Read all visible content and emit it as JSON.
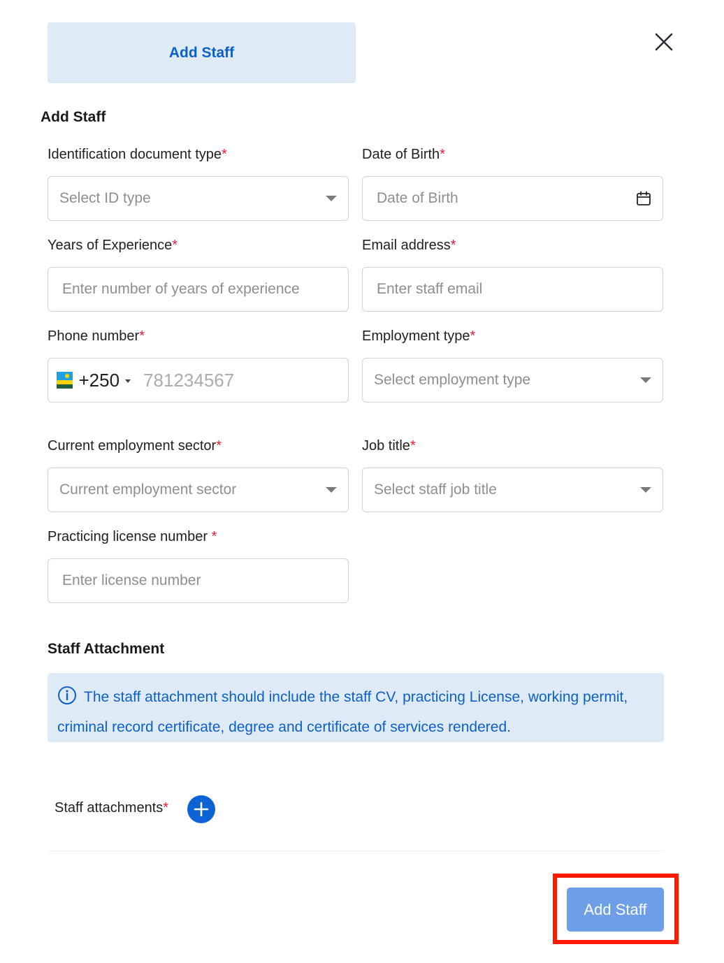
{
  "header": {
    "tab_label": "Add Staff"
  },
  "form": {
    "title": "Add Staff",
    "required_mark": "*",
    "id_type": {
      "label": "Identification document type",
      "placeholder": "Select ID type"
    },
    "dob": {
      "label": "Date of Birth",
      "placeholder": "Date of Birth"
    },
    "experience": {
      "label": "Years of Experience",
      "placeholder": "Enter number of years of experience"
    },
    "email": {
      "label": "Email address",
      "placeholder": "Enter staff email"
    },
    "phone": {
      "label": "Phone number",
      "dial_code": "+250",
      "placeholder": "781234567",
      "country_flag": "rwanda-flag"
    },
    "employment_type": {
      "label": "Employment type",
      "placeholder": "Select employment type"
    },
    "sector": {
      "label": "Current employment sector",
      "placeholder": "Current employment sector"
    },
    "job_title": {
      "label": "Job title",
      "placeholder": "Select staff job title"
    },
    "license": {
      "label": "Practicing license number ",
      "placeholder": "Enter license number"
    }
  },
  "attachments": {
    "title": "Staff Attachment",
    "info_text": "The staff attachment should include the staff CV, practicing License, working permit, criminal record certificate, degree and certificate of services rendered.",
    "label": "Staff attachments"
  },
  "footer": {
    "submit_label": "Add Staff"
  },
  "colors": {
    "accent": "#0d5fc9",
    "info_bg": "#deebf7",
    "required": "#e8203a",
    "submit_bg": "#6d9ee8",
    "highlight": "#ff1a00"
  }
}
